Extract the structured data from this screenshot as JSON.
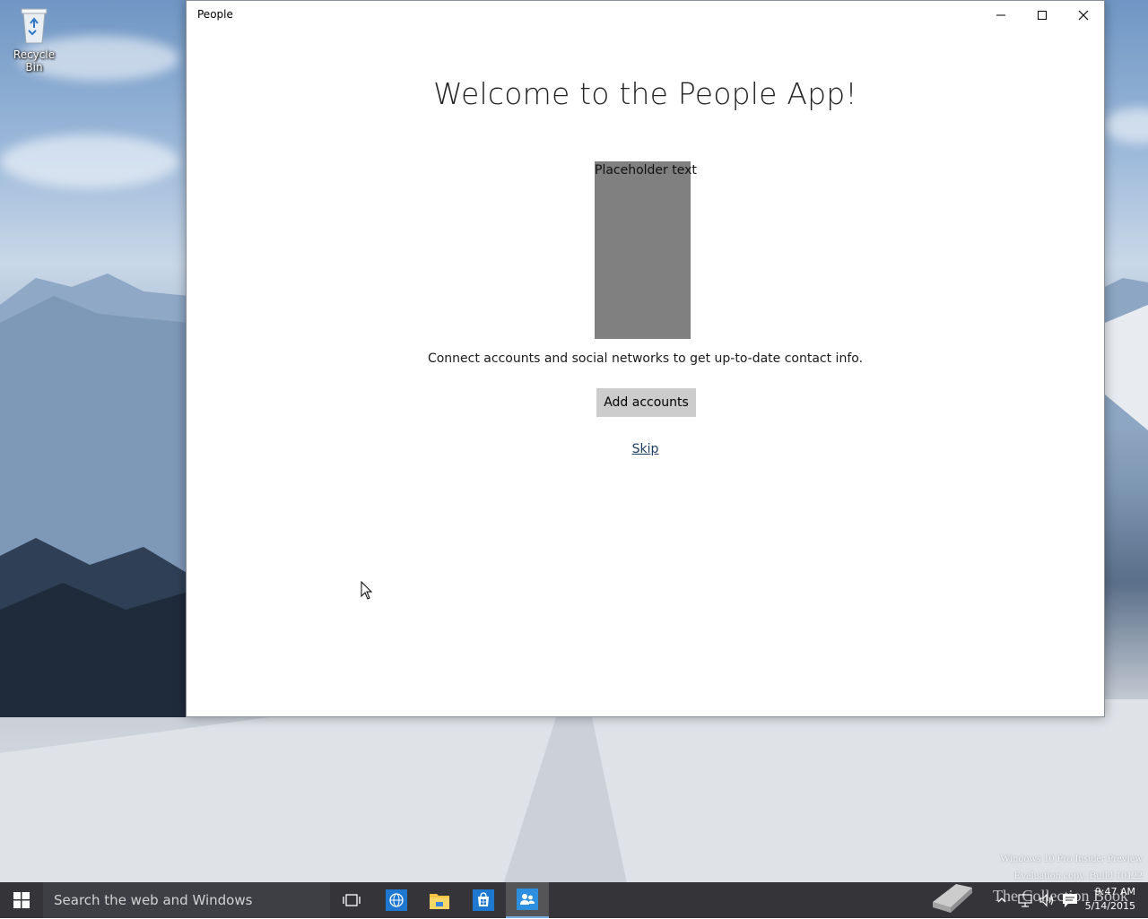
{
  "desktop": {
    "icons": [
      {
        "label": "Recycle Bin",
        "icon": "recycle-bin-icon"
      }
    ],
    "watermark": {
      "line1": "Windows 10 Pro Insider Preview",
      "line2": "Evaluation copy. Build 10122",
      "overlay": "The Collection Book"
    }
  },
  "window": {
    "title": "People",
    "controls": [
      "minimize",
      "maximize",
      "close"
    ],
    "content": {
      "heading": "Welcome to the People App!",
      "placeholder_label": "Placeholder text",
      "description": "Connect accounts and social networks to get up-to-date contact info.",
      "primary_button": "Add accounts",
      "skip_link": "Skip"
    }
  },
  "taskbar": {
    "search_placeholder": "Search the web and Windows",
    "pinned": [
      {
        "name": "task-view",
        "icon": "task-view-icon"
      },
      {
        "name": "edge",
        "icon": "globe-icon"
      },
      {
        "name": "file-explorer",
        "icon": "folder-icon"
      },
      {
        "name": "store",
        "icon": "store-icon"
      },
      {
        "name": "people",
        "icon": "people-icon",
        "active": true
      }
    ],
    "clock": {
      "time": "9:47 AM",
      "date": "5/14/2015"
    }
  },
  "colors": {
    "accent": "#7aaee0",
    "taskbar": "#141418",
    "button_gray": "#cccccc",
    "placeholder_gray": "#808080"
  }
}
